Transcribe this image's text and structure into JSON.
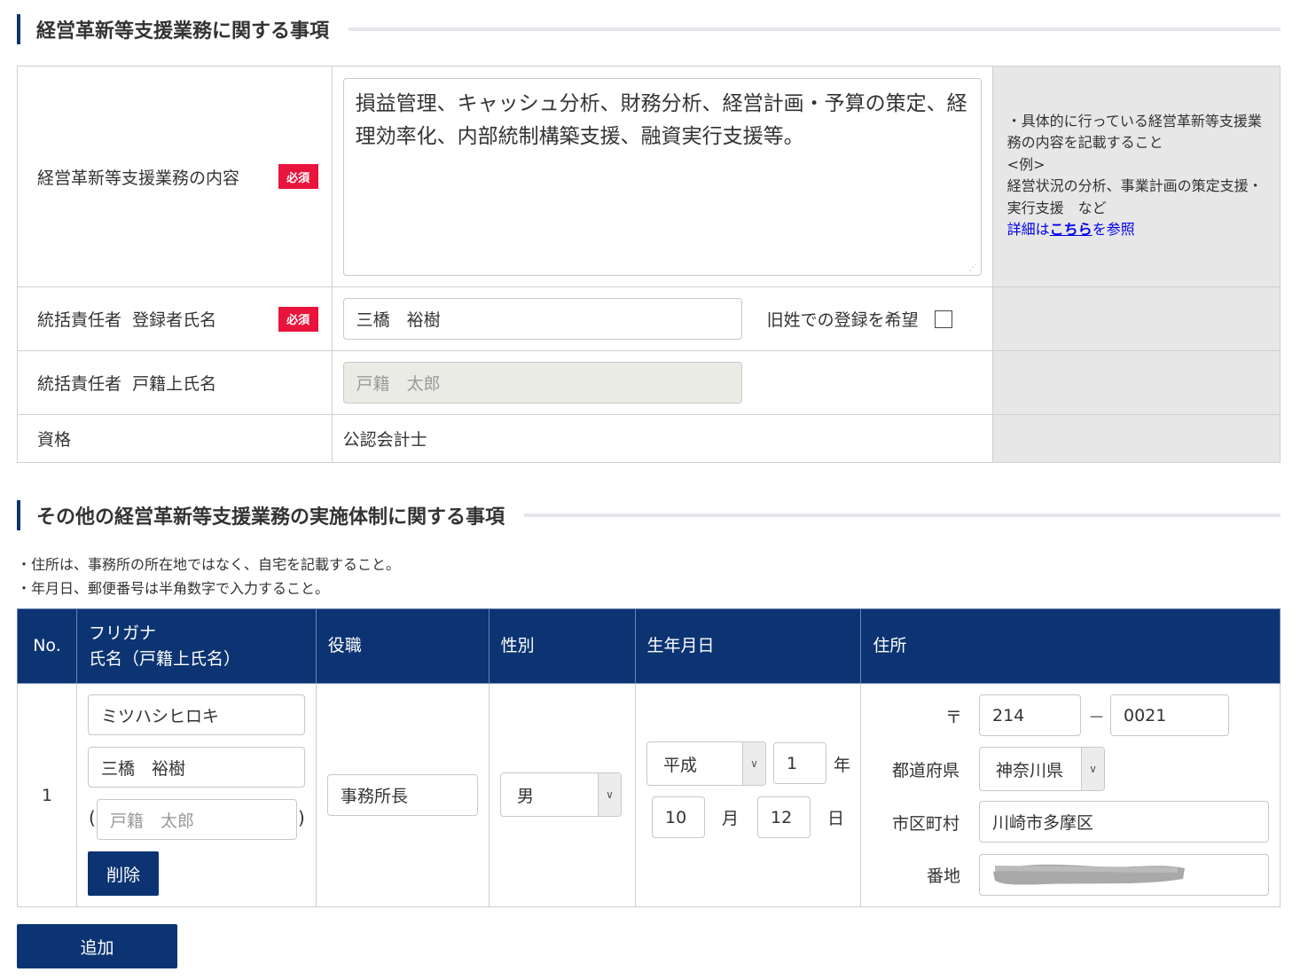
{
  "section1": {
    "title": "経営革新等支援業務に関する事項",
    "required_badge": "必須",
    "rows": {
      "content_label": "経営革新等支援業務の内容",
      "content_value": "損益管理、キャッシュ分析、財務分析、経営計画・予算の策定、経理効率化、内部統制構築支援、融資実行支援等。",
      "content_note_lines": [
        "・具体的に行っている経営革新等支援業務の内容を記載すること",
        "<例>",
        "経営状況の分析、事業計画の策定支援・実行支援　など"
      ],
      "note_link_prefix": "詳細は",
      "note_link_text": "こちら",
      "note_link_suffix": "を参照",
      "registrant_label": "統括責任者  登録者氏名",
      "registrant_value": "三橋　裕樹",
      "maiden_label": "旧姓での登録を希望",
      "koseki_label": "統括責任者  戸籍上氏名",
      "koseki_placeholder": "戸籍　太郎",
      "qualification_label": "資格",
      "qualification_value": "公認会計士"
    }
  },
  "section2": {
    "title": "その他の経営革新等支援業務の実施体制に関する事項",
    "notes": [
      "・住所は、事務所の所在地ではなく、自宅を記載すること。",
      "・年月日、郵便番号は半角数字で入力すること。"
    ],
    "headers": {
      "no": "No.",
      "furigana": "フリガナ",
      "name": "氏名（戸籍上氏名）",
      "position": "役職",
      "gender": "性別",
      "dob": "生年月日",
      "address": "住所"
    },
    "row": {
      "no": "1",
      "furigana": "ミツハシヒロキ",
      "name": "三橋　裕樹",
      "koseki_paren_open": "(",
      "koseki_placeholder": "戸籍　太郎",
      "koseki_paren_close": ")",
      "delete_label": "削除",
      "position": "事務所長",
      "gender": "男",
      "era": "平成",
      "year": "1",
      "year_unit": "年",
      "month": "10",
      "month_unit": "月",
      "day": "12",
      "day_unit": "日",
      "postal_mark": "〒",
      "postal1": "214",
      "postal_dash": "－",
      "postal2": "0021",
      "pref_label": "都道府県",
      "pref_value": "神奈川県",
      "city_label": "市区町村",
      "city_value": "川崎市多摩区",
      "street_label": "番地"
    },
    "add_label": "追加"
  },
  "colors": {
    "navy": "#0c3473",
    "required_red": "#e8143c",
    "note_bg": "#e7e7e7"
  }
}
